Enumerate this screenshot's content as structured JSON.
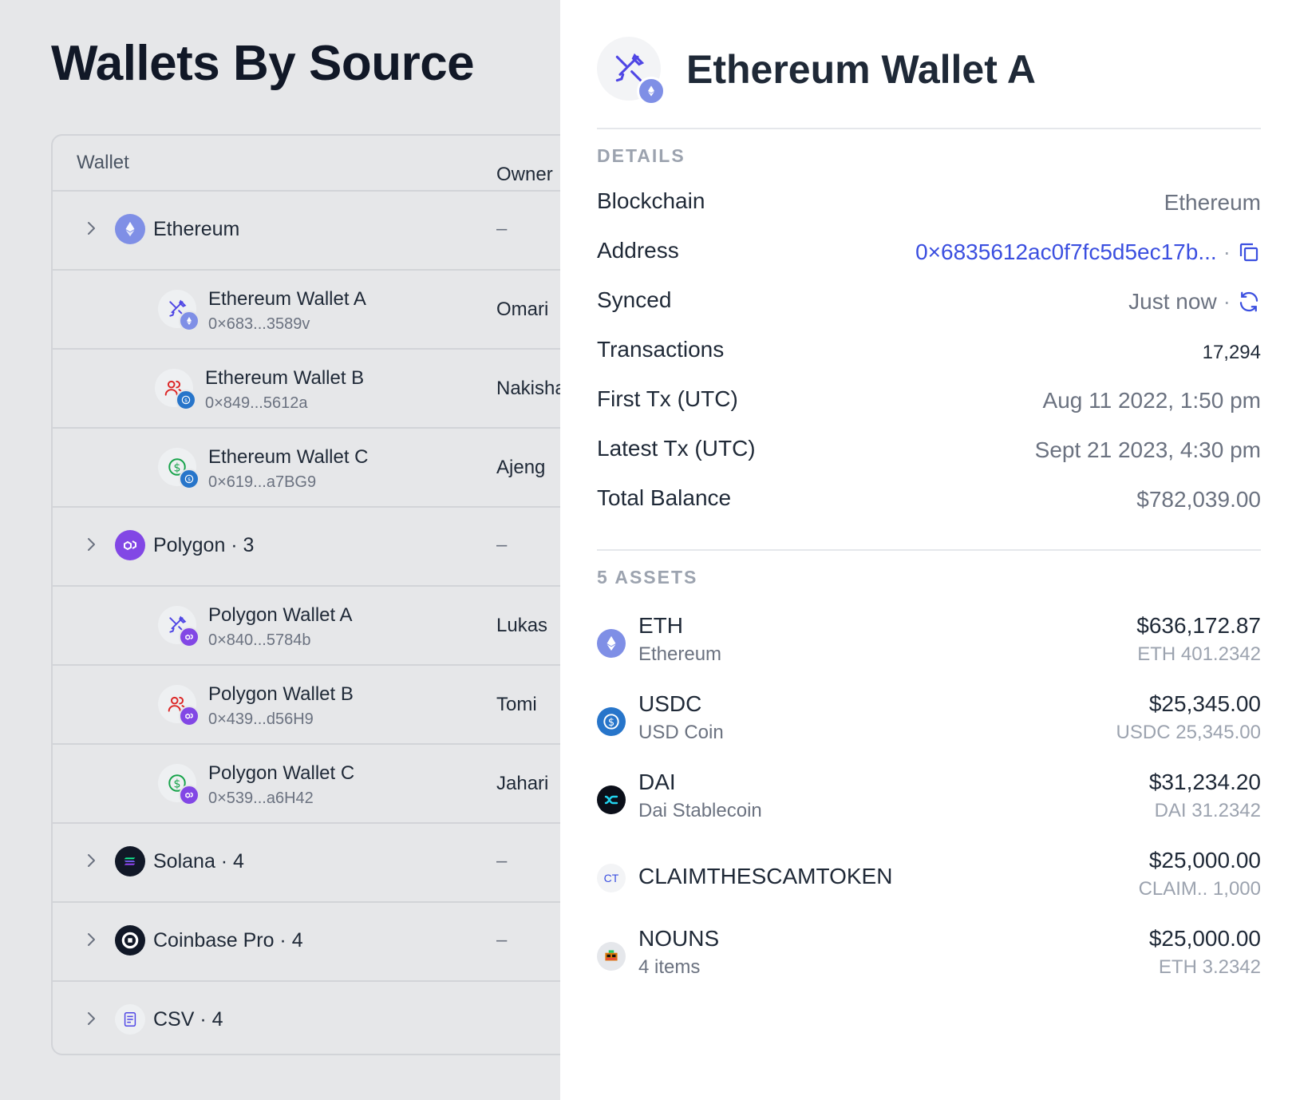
{
  "page": {
    "title": "Wallets By Source"
  },
  "table": {
    "headers": {
      "wallet": "Wallet",
      "owner": "Owner"
    },
    "rows": [
      {
        "kind": "group",
        "label": "Ethereum",
        "owner": "–",
        "icon": "ethereum-icon"
      },
      {
        "kind": "wallet",
        "name": "Ethereum Wallet A",
        "address": "0×683...3589v",
        "owner": "Omari",
        "icon": "tools-icon",
        "badge": "ethereum-icon"
      },
      {
        "kind": "wallet",
        "name": "Ethereum Wallet B",
        "address": "0×849...5612a",
        "owner": "Nakisha",
        "icon": "users-icon",
        "badge": "usdc-icon"
      },
      {
        "kind": "wallet",
        "name": "Ethereum Wallet C",
        "address": "0×619...a7BG9",
        "owner": "Ajeng",
        "icon": "dollar-icon",
        "badge": "usdc-icon"
      },
      {
        "kind": "group",
        "label": "Polygon · 3",
        "owner": "–",
        "icon": "polygon-icon"
      },
      {
        "kind": "wallet",
        "name": "Polygon Wallet A",
        "address": "0×840...5784b",
        "owner": "Lukas",
        "icon": "tools-icon",
        "badge": "polygon-icon"
      },
      {
        "kind": "wallet",
        "name": "Polygon Wallet B",
        "address": "0×439...d56H9",
        "owner": "Tomi",
        "icon": "users-icon",
        "badge": "polygon-icon"
      },
      {
        "kind": "wallet",
        "name": "Polygon Wallet C",
        "address": "0×539...a6H42",
        "owner": "Jahari",
        "icon": "dollar-icon",
        "badge": "polygon-icon"
      },
      {
        "kind": "group",
        "label": "Solana · 4",
        "owner": "–",
        "icon": "solana-icon"
      },
      {
        "kind": "group",
        "label": "Coinbase Pro · 4",
        "owner": "–",
        "icon": "coinbase-icon"
      },
      {
        "kind": "group",
        "label": "CSV · 4",
        "owner": "",
        "icon": "csv-icon"
      }
    ]
  },
  "drawer": {
    "title": "Ethereum Wallet A",
    "details_label": "DETAILS",
    "details": {
      "blockchain": {
        "label": "Blockchain",
        "value": "Ethereum"
      },
      "address": {
        "label": "Address",
        "value": "0×6835612ac0f7fc5d5ec17b...",
        "sep": "·"
      },
      "synced": {
        "label": "Synced",
        "value": "Just now",
        "sep": "·"
      },
      "transactions": {
        "label": "Transactions",
        "value": "17,294"
      },
      "first_tx": {
        "label": "First Tx (UTC)",
        "value": "Aug 11 2022, 1:50 pm"
      },
      "latest_tx": {
        "label": "Latest Tx (UTC)",
        "value": "Sept 21 2023, 4:30 pm"
      },
      "total_balance": {
        "label": "Total Balance",
        "value": "$782,039.00"
      }
    },
    "assets_label": "5 ASSETS",
    "assets": [
      {
        "symbol": "ETH",
        "name": "Ethereum",
        "usd": "$636,172.87",
        "amount": "ETH 401.2342",
        "icon": "ethereum-icon"
      },
      {
        "symbol": "USDC",
        "name": "USD Coin",
        "usd": "$25,345.00",
        "amount": "USDC 25,345.00",
        "icon": "usdc-icon"
      },
      {
        "symbol": "DAI",
        "name": "Dai Stablecoin",
        "usd": "$31,234.20",
        "amount": "DAI 31.2342",
        "icon": "dai-icon"
      },
      {
        "symbol": "CLAIMTHESCAMTOKEN",
        "name": "",
        "usd": "$25,000.00",
        "amount": "CLAIM.. 1,000",
        "icon": "ct-token-icon",
        "icon_text": "CT"
      },
      {
        "symbol": "NOUNS",
        "name": "4 items",
        "usd": "$25,000.00",
        "amount": "ETH 3.2342",
        "icon": "nouns-icon"
      }
    ]
  },
  "colors": {
    "accent": "#3b4fe0",
    "ethereum": "#7f8fe6",
    "polygon": "#8247e5",
    "usdc": "#2775ca",
    "tools": "#4f46e5",
    "users": "#dc2626",
    "dollar": "#16a34a"
  }
}
